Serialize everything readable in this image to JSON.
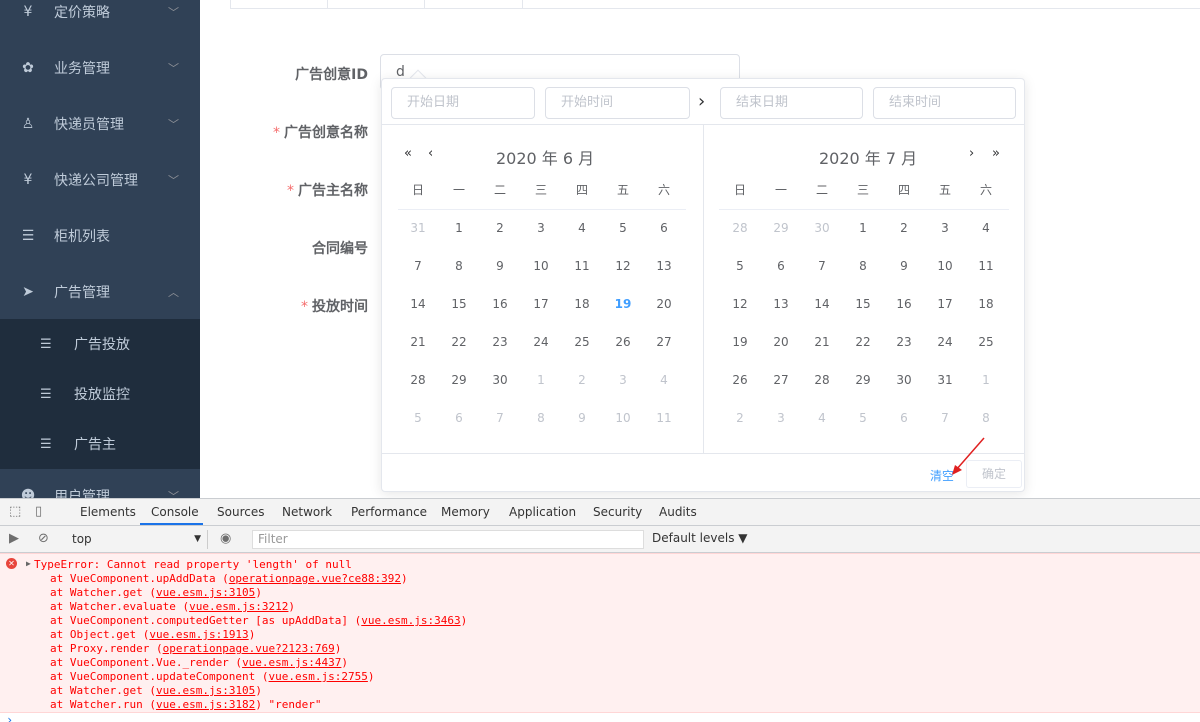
{
  "sidebar": {
    "items": [
      {
        "label": "定价策略",
        "icon": "yen-icon",
        "glyph": "¥"
      },
      {
        "label": "业务管理",
        "icon": "gear-icon",
        "glyph": "✿"
      },
      {
        "label": "快递员管理",
        "icon": "courier-icon",
        "glyph": "♙"
      },
      {
        "label": "快递公司管理",
        "icon": "yen-icon",
        "glyph": "¥"
      },
      {
        "label": "柜机列表",
        "icon": "list-icon",
        "glyph": "☰"
      },
      {
        "label": "广告管理",
        "icon": "send-icon",
        "glyph": "➤"
      },
      {
        "label": "用户管理",
        "icon": "user-icon",
        "glyph": "☻"
      }
    ],
    "subitems": [
      {
        "label": "广告投放",
        "icon": "list-icon",
        "glyph": "☰"
      },
      {
        "label": "投放监控",
        "icon": "list-icon",
        "glyph": "☰"
      },
      {
        "label": "广告主",
        "icon": "list-icon",
        "glyph": "☰"
      }
    ]
  },
  "form": {
    "id_label": "广告创意ID",
    "name_label": "广告创意名称",
    "advertiser_label": "广告主名称",
    "contract_label": "合同编号",
    "time_label": "投放时间",
    "required_mark": "*",
    "id_value": "d"
  },
  "picker": {
    "start_date_placeholder": "开始日期",
    "start_time_placeholder": "开始时间",
    "end_date_placeholder": "结束日期",
    "end_time_placeholder": "结束时间",
    "separator": "›",
    "left_title": "2020 年 6 月",
    "right_title": "2020 年 7 月",
    "prev_year": "«",
    "prev_month": "‹",
    "next_month": "›",
    "next_year": "»",
    "weekdays": [
      "日",
      "一",
      "二",
      "三",
      "四",
      "五",
      "六"
    ],
    "left_days": [
      [
        "31",
        "1",
        "2",
        "3",
        "4",
        "5",
        "6"
      ],
      [
        "7",
        "8",
        "9",
        "10",
        "11",
        "12",
        "13"
      ],
      [
        "14",
        "15",
        "16",
        "17",
        "18",
        "19",
        "20"
      ],
      [
        "21",
        "22",
        "23",
        "24",
        "25",
        "26",
        "27"
      ],
      [
        "28",
        "29",
        "30",
        "1",
        "2",
        "3",
        "4"
      ],
      [
        "5",
        "6",
        "7",
        "8",
        "9",
        "10",
        "11"
      ]
    ],
    "right_days": [
      [
        "28",
        "29",
        "30",
        "1",
        "2",
        "3",
        "4"
      ],
      [
        "5",
        "6",
        "7",
        "8",
        "9",
        "10",
        "11"
      ],
      [
        "12",
        "13",
        "14",
        "15",
        "16",
        "17",
        "18"
      ],
      [
        "19",
        "20",
        "21",
        "22",
        "23",
        "24",
        "25"
      ],
      [
        "26",
        "27",
        "28",
        "29",
        "30",
        "31",
        "1"
      ],
      [
        "2",
        "3",
        "4",
        "5",
        "6",
        "7",
        "8"
      ]
    ],
    "clear_label": "清空",
    "confirm_label": "确定"
  },
  "devtools": {
    "tabs": [
      "Elements",
      "Console",
      "Sources",
      "Network",
      "Performance",
      "Memory",
      "Application",
      "Security",
      "Audits"
    ],
    "active_tab": "Console",
    "context": "top",
    "filter_placeholder": "Filter",
    "levels": "Default levels ▼",
    "error_title": "TypeError: Cannot read property 'length' of null",
    "stack": [
      {
        "text": "at VueComponent.upAddData (",
        "link": "operationpage.vue?ce88:392",
        "tail": ")"
      },
      {
        "text": "at Watcher.get (",
        "link": "vue.esm.js:3105",
        "tail": ")"
      },
      {
        "text": "at Watcher.evaluate (",
        "link": "vue.esm.js:3212",
        "tail": ")"
      },
      {
        "text": "at VueComponent.computedGetter [as upAddData] (",
        "link": "vue.esm.js:3463",
        "tail": ")"
      },
      {
        "text": "at Object.get (",
        "link": "vue.esm.js:1913",
        "tail": ")"
      },
      {
        "text": "at Proxy.render (",
        "link": "operationpage.vue?2123:769",
        "tail": ")"
      },
      {
        "text": "at VueComponent.Vue._render (",
        "link": "vue.esm.js:4437",
        "tail": ")"
      },
      {
        "text": "at VueComponent.updateComponent (",
        "link": "vue.esm.js:2755",
        "tail": ")"
      },
      {
        "text": "at Watcher.get (",
        "link": "vue.esm.js:3105",
        "tail": ")"
      },
      {
        "text": "at Watcher.run (",
        "link": "vue.esm.js:3182",
        "tail": ") \"render\""
      }
    ],
    "prompt": "›"
  },
  "colors": {
    "sidebar_bg": "#304156",
    "submenu_bg": "#1f2d3d",
    "accent": "#409eff",
    "required": "#f56c6c",
    "error_text": "#ff0000",
    "error_bg": "#fff0f0"
  }
}
